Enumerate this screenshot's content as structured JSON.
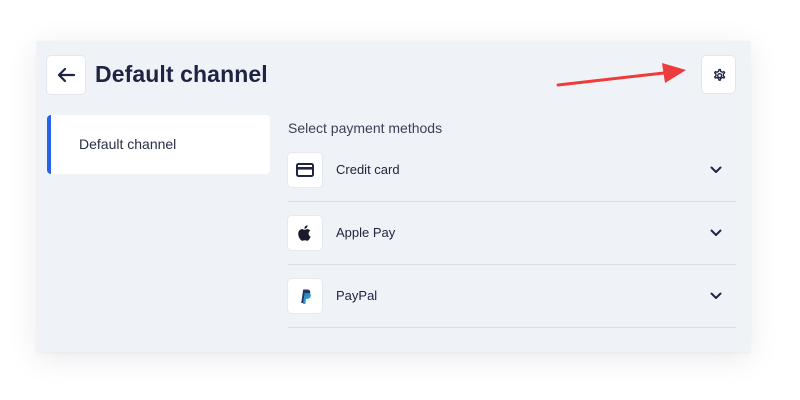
{
  "header": {
    "back_icon": "arrow-left-icon",
    "title": "Default channel",
    "settings_icon": "gear-icon"
  },
  "annotation": {
    "color": "#ee3b3b",
    "icon": "arrow-right-icon"
  },
  "sidebar": {
    "items": [
      {
        "label": "Default channel",
        "selected": true
      }
    ],
    "accent_color": "#2563eb"
  },
  "payment": {
    "section_label": "Select payment methods",
    "methods": [
      {
        "label": "Credit card",
        "icon": "credit-card-icon"
      },
      {
        "label": "Apple Pay",
        "icon": "apple-icon"
      },
      {
        "label": "PayPal",
        "icon": "paypal-icon"
      }
    ]
  },
  "colors": {
    "title": "#202443",
    "panel_background": "#eff3f8"
  }
}
